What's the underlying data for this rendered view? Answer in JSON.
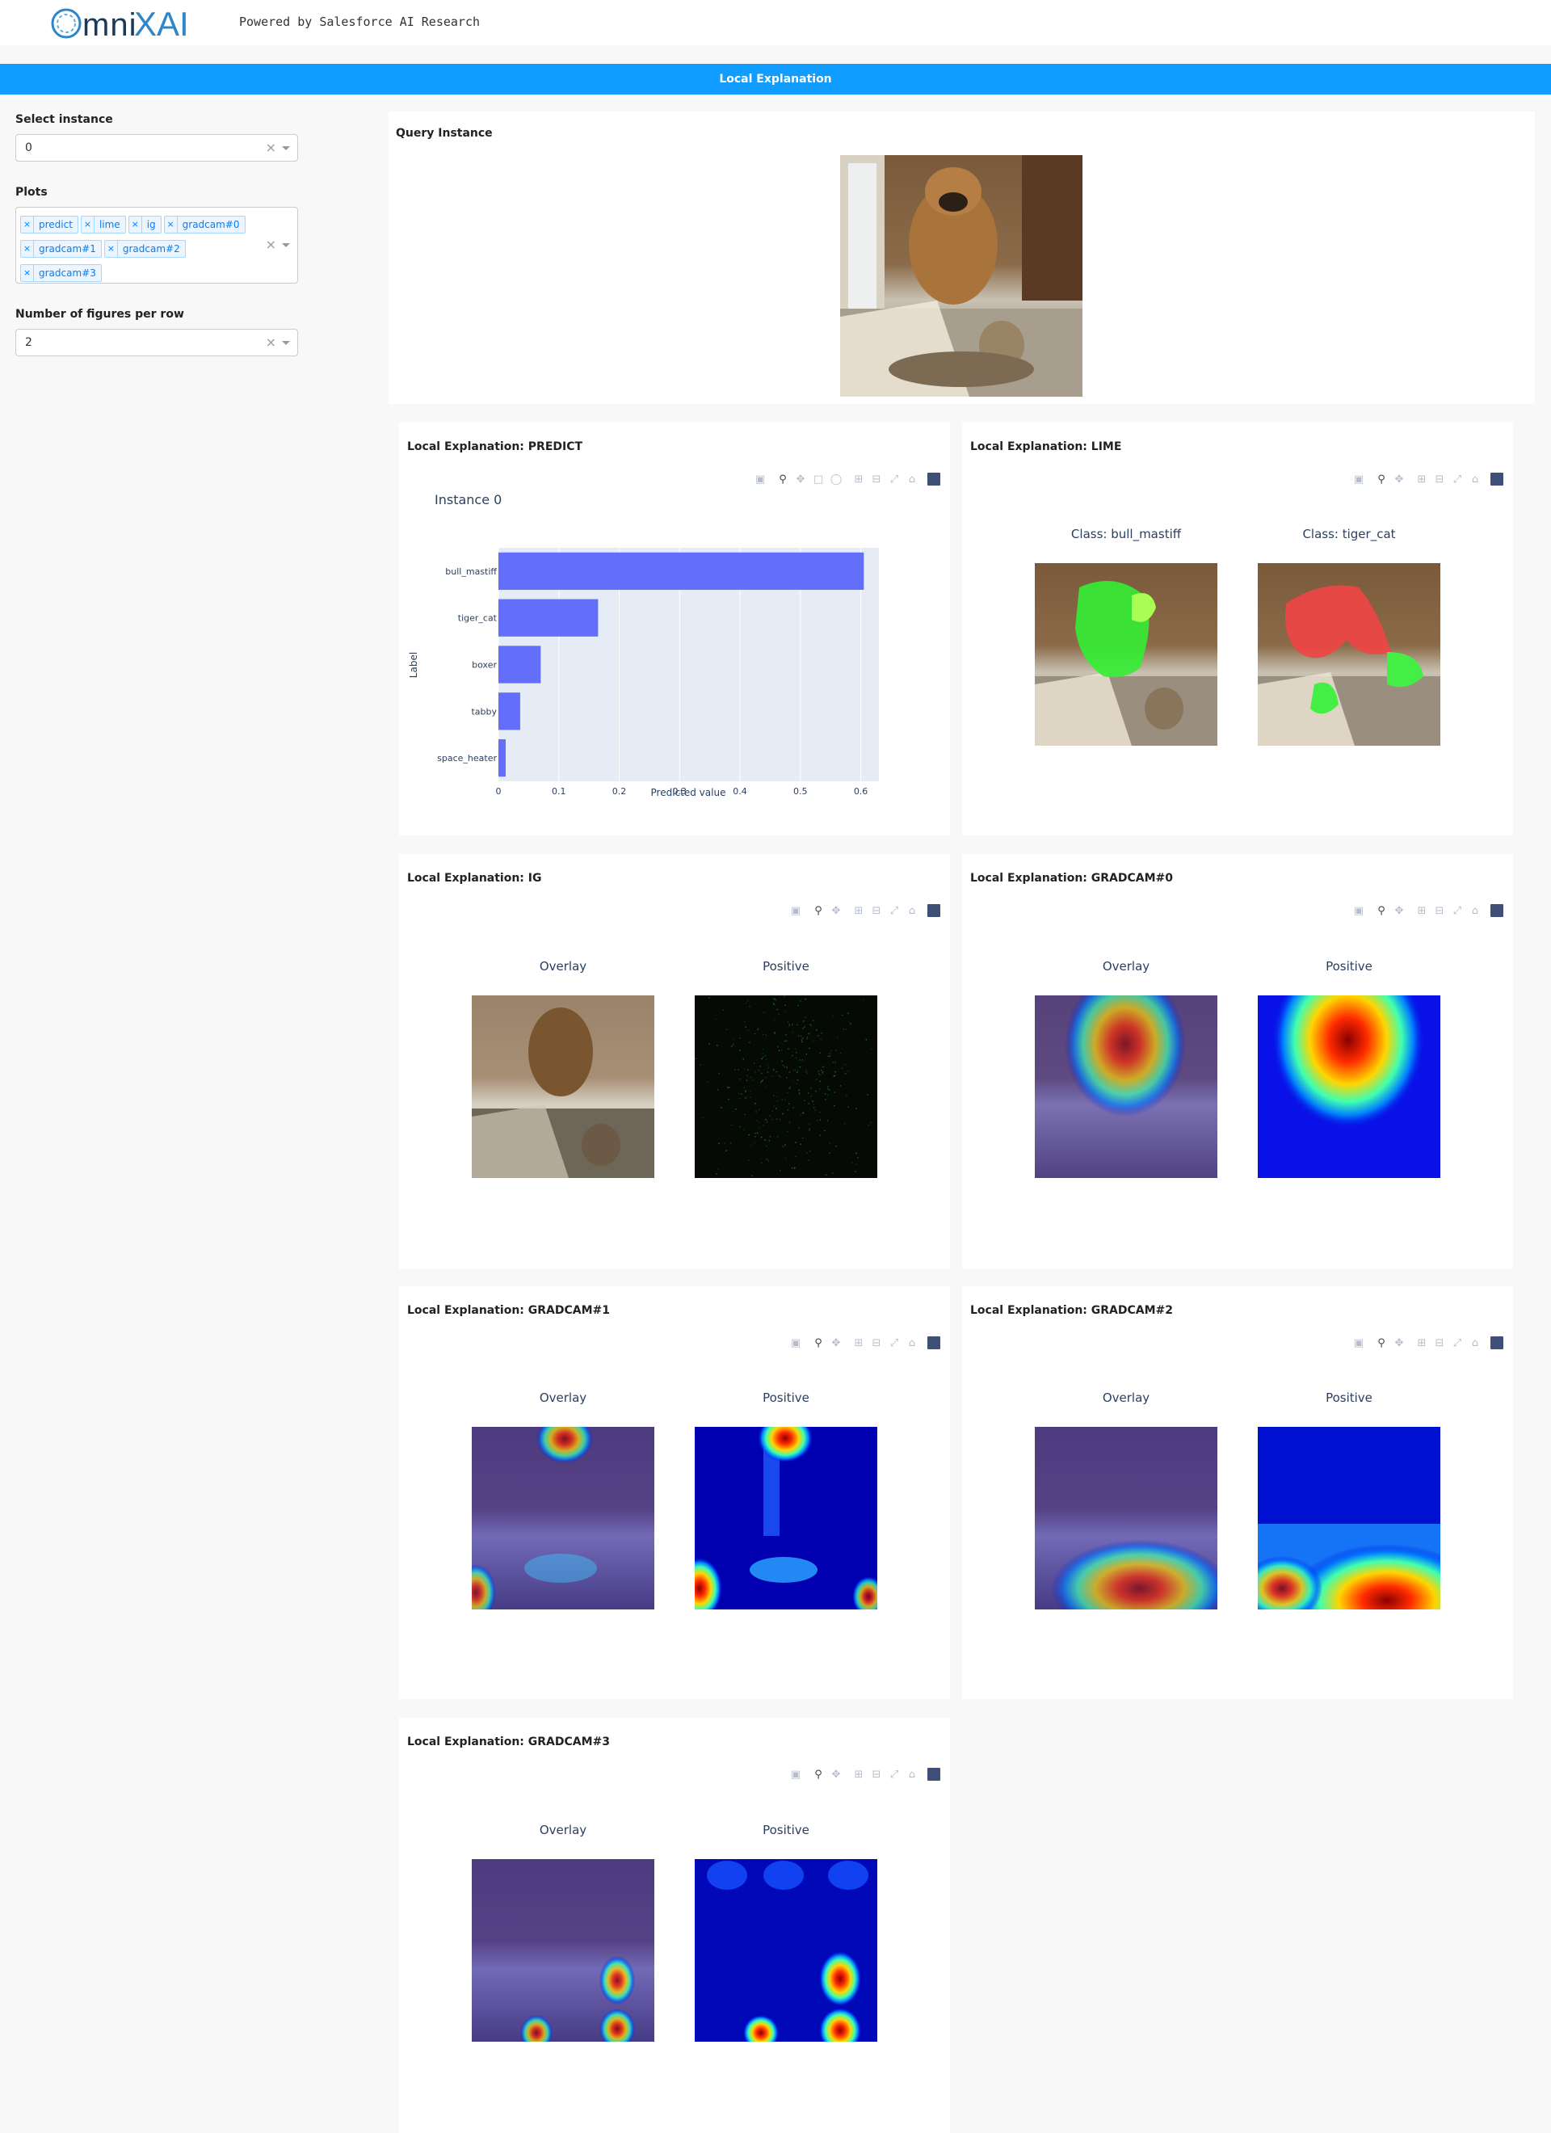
{
  "header": {
    "logo_text": "OmniXAI",
    "powered_by": "Powered by Salesforce AI Research"
  },
  "banner": {
    "title": "Local Explanation"
  },
  "sidebar": {
    "instance_label": "Select instance",
    "instance_value": "0",
    "plots_label": "Plots",
    "plots_selected": [
      "predict",
      "lime",
      "ig",
      "gradcam#0",
      "gradcam#1",
      "gradcam#2",
      "gradcam#3"
    ],
    "per_row_label": "Number of figures per row",
    "per_row_value": "2",
    "clear_symbol": "×"
  },
  "query": {
    "title": "Query Instance"
  },
  "cards": {
    "predict": {
      "title": "Local Explanation: PREDICT",
      "plot_title": "Instance 0"
    },
    "lime": {
      "title": "Local Explanation: LIME",
      "panel_left": "Class: bull_mastiff",
      "panel_right": "Class: tiger_cat"
    },
    "ig": {
      "title": "Local Explanation: IG",
      "panel_left": "Overlay",
      "panel_right": "Positive"
    },
    "gradcam0": {
      "title": "Local Explanation: GRADCAM#0",
      "panel_left": "Overlay",
      "panel_right": "Positive"
    },
    "gradcam1": {
      "title": "Local Explanation: GRADCAM#1",
      "panel_left": "Overlay",
      "panel_right": "Positive"
    },
    "gradcam2": {
      "title": "Local Explanation: GRADCAM#2",
      "panel_left": "Overlay",
      "panel_right": "Positive"
    },
    "gradcam3": {
      "title": "Local Explanation: GRADCAM#3",
      "panel_left": "Overlay",
      "panel_right": "Positive"
    }
  },
  "chart_data": {
    "type": "bar",
    "orientation": "horizontal",
    "title": "Instance 0",
    "categories": [
      "bull_mastiff",
      "tiger_cat",
      "boxer",
      "tabby",
      "space_heater"
    ],
    "values": [
      0.605,
      0.165,
      0.07,
      0.036,
      0.012
    ],
    "xlabel": "Predicted value",
    "ylabel": "Label",
    "xlim": [
      0,
      0.63
    ],
    "xticks": [
      0,
      0.1,
      0.2,
      0.3,
      0.4,
      0.5,
      0.6
    ],
    "xtick_labels": [
      "0",
      "0.1",
      "0.2",
      "0.3",
      "0.4",
      "0.5",
      "0.6"
    ],
    "bar_color": "#636efa",
    "plot_bg": "#e5ecf6",
    "grid": true
  }
}
